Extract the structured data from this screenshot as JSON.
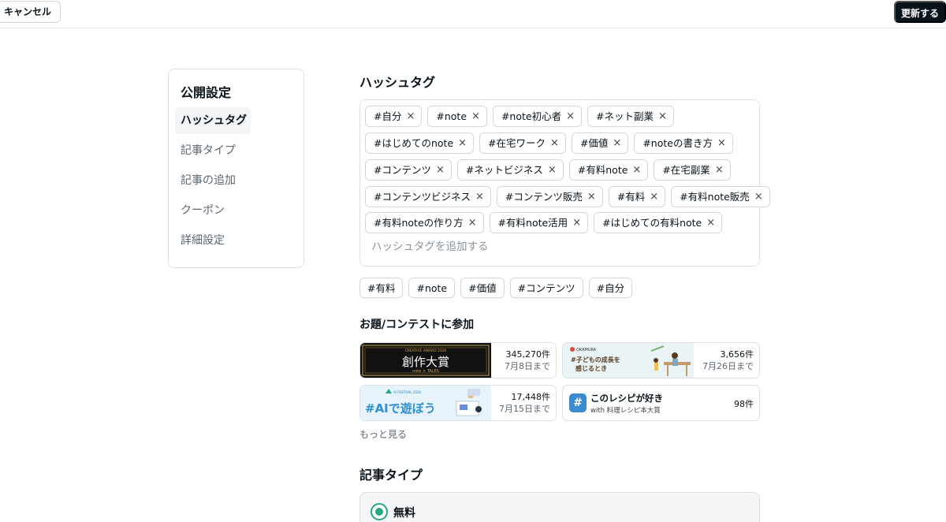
{
  "topbar": {
    "cancel_label": "キャンセル",
    "update_label": "更新する"
  },
  "sidenav": {
    "title": "公開設定",
    "items": [
      {
        "label": "ハッシュタグ",
        "active": true
      },
      {
        "label": "記事タイプ",
        "active": false
      },
      {
        "label": "記事の追加",
        "active": false
      },
      {
        "label": "クーポン",
        "active": false
      },
      {
        "label": "詳細設定",
        "active": false
      }
    ]
  },
  "hashtags": {
    "heading": "ハッシュタグ",
    "rows": [
      [
        "#自分",
        "#note",
        "#note初心者",
        "#ネット副業"
      ],
      [
        "#はじめてのnote",
        "#在宅ワーク",
        "#価値",
        "#noteの書き方"
      ],
      [
        "#コンテンツ",
        "#ネットビジネス",
        "#有料note",
        "#在宅副業"
      ],
      [
        "#コンテンツビジネス",
        "#コンテンツ販売",
        "#有料",
        "#有料note販売"
      ],
      [
        "#有料noteの作り方",
        "#有料note活用",
        "#はじめての有料note"
      ]
    ],
    "remove_glyph": "×",
    "input_placeholder": "ハッシュタグを追加する",
    "suggestions": [
      "#有料",
      "#note",
      "#価値",
      "#コンテンツ",
      "#自分"
    ]
  },
  "contests": {
    "heading": "お題/コンテストに参加",
    "items": [
      {
        "count": "345,270件",
        "deadline": "7月8日まで",
        "banner_caption": "CREATIVE AWARD 2026",
        "banner_title": "創作大賞",
        "banner_sub": "note × TALES"
      },
      {
        "count": "3,656件",
        "deadline": "7月26日まで",
        "banner_brand": "OKAMURA",
        "banner_title_line1": "#子どもの成長を",
        "banner_title_line2": "感じるとき"
      },
      {
        "count": "17,448件",
        "deadline": "7月15日まで",
        "banner_caption": "AI FESTIVAL 2026",
        "banner_title": "#AIで遊ぼう"
      },
      {
        "count": "98件",
        "title": "このレシピが好き",
        "sub": "with 料理レシピ本大賞",
        "icon_glyph": "#"
      }
    ],
    "more_label": "もっと見る"
  },
  "article_type": {
    "heading": "記事タイプ",
    "selected_label": "無料"
  },
  "colors": {
    "accent": "#2aa686",
    "primary_button": "#08131a",
    "border": "#dcdfe2"
  }
}
